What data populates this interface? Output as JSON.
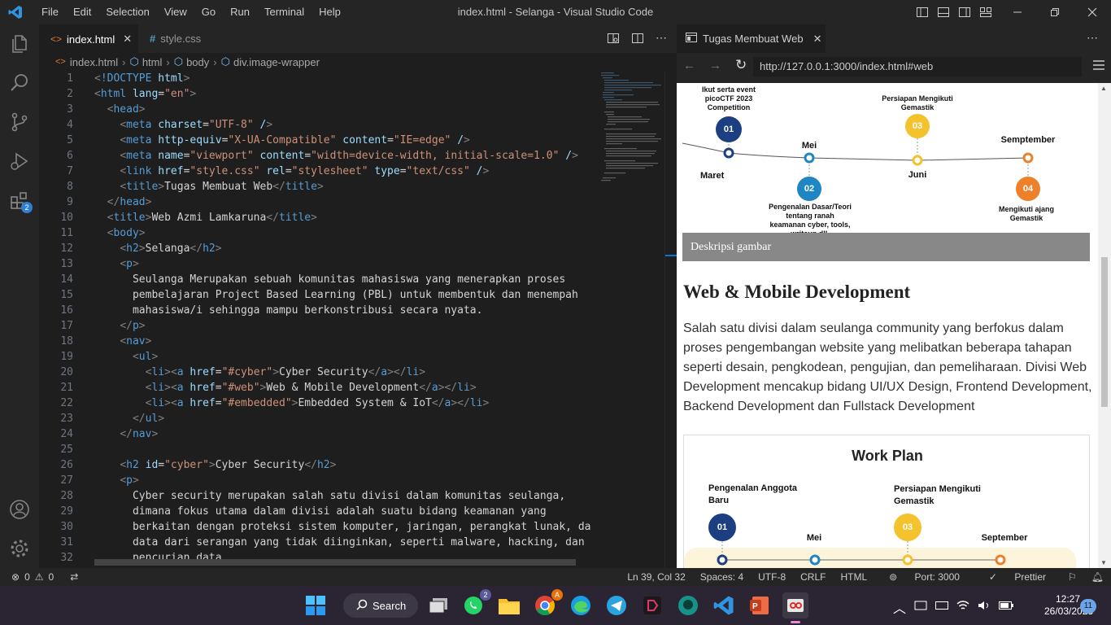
{
  "title_bar": {
    "menu": [
      "File",
      "Edit",
      "Selection",
      "View",
      "Go",
      "Run",
      "Terminal",
      "Help"
    ],
    "window_title": "index.html - Selanga - Visual Studio Code"
  },
  "activity_bar": {
    "extensions_badge": "2"
  },
  "tabs": [
    {
      "label": "index.html",
      "active": true
    },
    {
      "label": "style.css",
      "active": false
    }
  ],
  "breadcrumb": [
    "index.html",
    "html",
    "body",
    "div.image-wrapper"
  ],
  "code": [
    {
      "n": "1",
      "t": "<!DOCTYPE html>"
    },
    {
      "n": "2",
      "t": "<html lang=\"en\">"
    },
    {
      "n": "3",
      "t": "  <head>"
    },
    {
      "n": "4",
      "t": "    <meta charset=\"UTF-8\" />"
    },
    {
      "n": "5",
      "t": "    <meta http-equiv=\"X-UA-Compatible\" content=\"IE=edge\" />"
    },
    {
      "n": "6",
      "t": "    <meta name=\"viewport\" content=\"width=device-width, initial-scale=1.0\" />"
    },
    {
      "n": "7",
      "t": "    <link href=\"style.css\" rel=\"stylesheet\" type=\"text/css\" />"
    },
    {
      "n": "8",
      "t": "    <title>Tugas Membuat Web</title>"
    },
    {
      "n": "9",
      "t": "  </head>"
    },
    {
      "n": "10",
      "t": "  <title>Web Azmi Lamkaruna</title>"
    },
    {
      "n": "11",
      "t": "  <body>"
    },
    {
      "n": "12",
      "t": "    <h2>Selanga</h2>"
    },
    {
      "n": "13",
      "t": "    <p>"
    },
    {
      "n": "14",
      "t": "      Seulanga Merupakan sebuah komunitas mahasiswa yang menerapkan proses"
    },
    {
      "n": "15",
      "t": "      pembelajaran Project Based Learning (PBL) untuk membentuk dan menempah"
    },
    {
      "n": "16",
      "t": "      mahasiswa/i sehingga mampu berkonstribusi secara nyata."
    },
    {
      "n": "17",
      "t": "    </p>"
    },
    {
      "n": "18",
      "t": "    <nav>"
    },
    {
      "n": "19",
      "t": "      <ul>"
    },
    {
      "n": "20",
      "t": "        <li><a href=\"#cyber\">Cyber Security</a></li>"
    },
    {
      "n": "21",
      "t": "        <li><a href=\"#web\">Web & Mobile Development</a></li>"
    },
    {
      "n": "22",
      "t": "        <li><a href=\"#embedded\">Embedded System & IoT</a></li>"
    },
    {
      "n": "23",
      "t": "      </ul>"
    },
    {
      "n": "24",
      "t": "    </nav>"
    },
    {
      "n": "25",
      "t": ""
    },
    {
      "n": "26",
      "t": "    <h2 id=\"cyber\">Cyber Security</h2>"
    },
    {
      "n": "27",
      "t": "    <p>"
    },
    {
      "n": "28",
      "t": "      Cyber security merupakan salah satu divisi dalam komunitas seulanga,"
    },
    {
      "n": "29",
      "t": "      dimana fokus utama dalam divisi adalah suatu bidang keamanan yang"
    },
    {
      "n": "30",
      "t": "      berkaitan dengan proteksi sistem komputer, jaringan, perangkat lunak, dan"
    },
    {
      "n": "31",
      "t": "      data dari serangan yang tidak diinginkan, seperti malware, hacking, dan"
    },
    {
      "n": "32",
      "t": "      pencurian data."
    }
  ],
  "preview": {
    "tab_label": "Tugas Membuat Web",
    "url": "http://127.0.0.1:3000/index.html#web",
    "timeline_top": {
      "items": [
        {
          "num": "01",
          "month": "Maret",
          "text": "Ikut serta event picoCTF 2023 Competition"
        },
        {
          "num": "02",
          "month": "Mei",
          "text": "Pengenalan Dasar/Teori tentang ranah keamanan cyber, tools, writeup dll."
        },
        {
          "num": "03",
          "month": "Juni",
          "text": "Persiapan Mengikuti Gemastik"
        },
        {
          "num": "04",
          "month": "Semptember",
          "text": "Mengikuti ajang Gemastik"
        }
      ]
    },
    "caption": "Deskripsi gambar",
    "heading": "Web & Mobile Development",
    "paragraph": "Salah satu divisi dalam seulanga community yang berfokus dalam proses pengembangan website yang melibatkan beberapa tahapan seperti desain, pengkodean, pengujian, dan pemeliharaan. Divisi Web Development mencakup bidang UI/UX Design, Frontend Development, Backend Development dan Fullstack Development",
    "workplan": {
      "title": "Work Plan",
      "label1": "Pengenalan Anggota Baru",
      "label3": "Persiapan Mengikuti Gemastik",
      "mei": "Mei",
      "september": "September",
      "num1": "01",
      "num3": "03"
    }
  },
  "status_bar": {
    "errors": "0",
    "warnings": "0",
    "position": "Ln 39, Col 32",
    "spaces": "Spaces: 4",
    "encoding": "UTF-8",
    "eol": "CRLF",
    "language": "HTML",
    "port": "Port: 3000",
    "prettier": "Prettier"
  },
  "taskbar": {
    "search": "Search",
    "whatsapp_badge": "2",
    "chrome_badge": "A",
    "time": "12:27",
    "date": "26/03/2023",
    "notifications": "11"
  },
  "colors": {
    "editor_bg": "#1e1e1e",
    "sidebar_bg": "#252526",
    "statusbar_bg": "#252526",
    "taskbar_bg": "#2b2533",
    "accent": "#007acc",
    "timeline_blue": "#1c3f82",
    "timeline_cyan": "#1f86c4",
    "timeline_yellow": "#f3c22d",
    "timeline_orange": "#ee7f2b"
  }
}
